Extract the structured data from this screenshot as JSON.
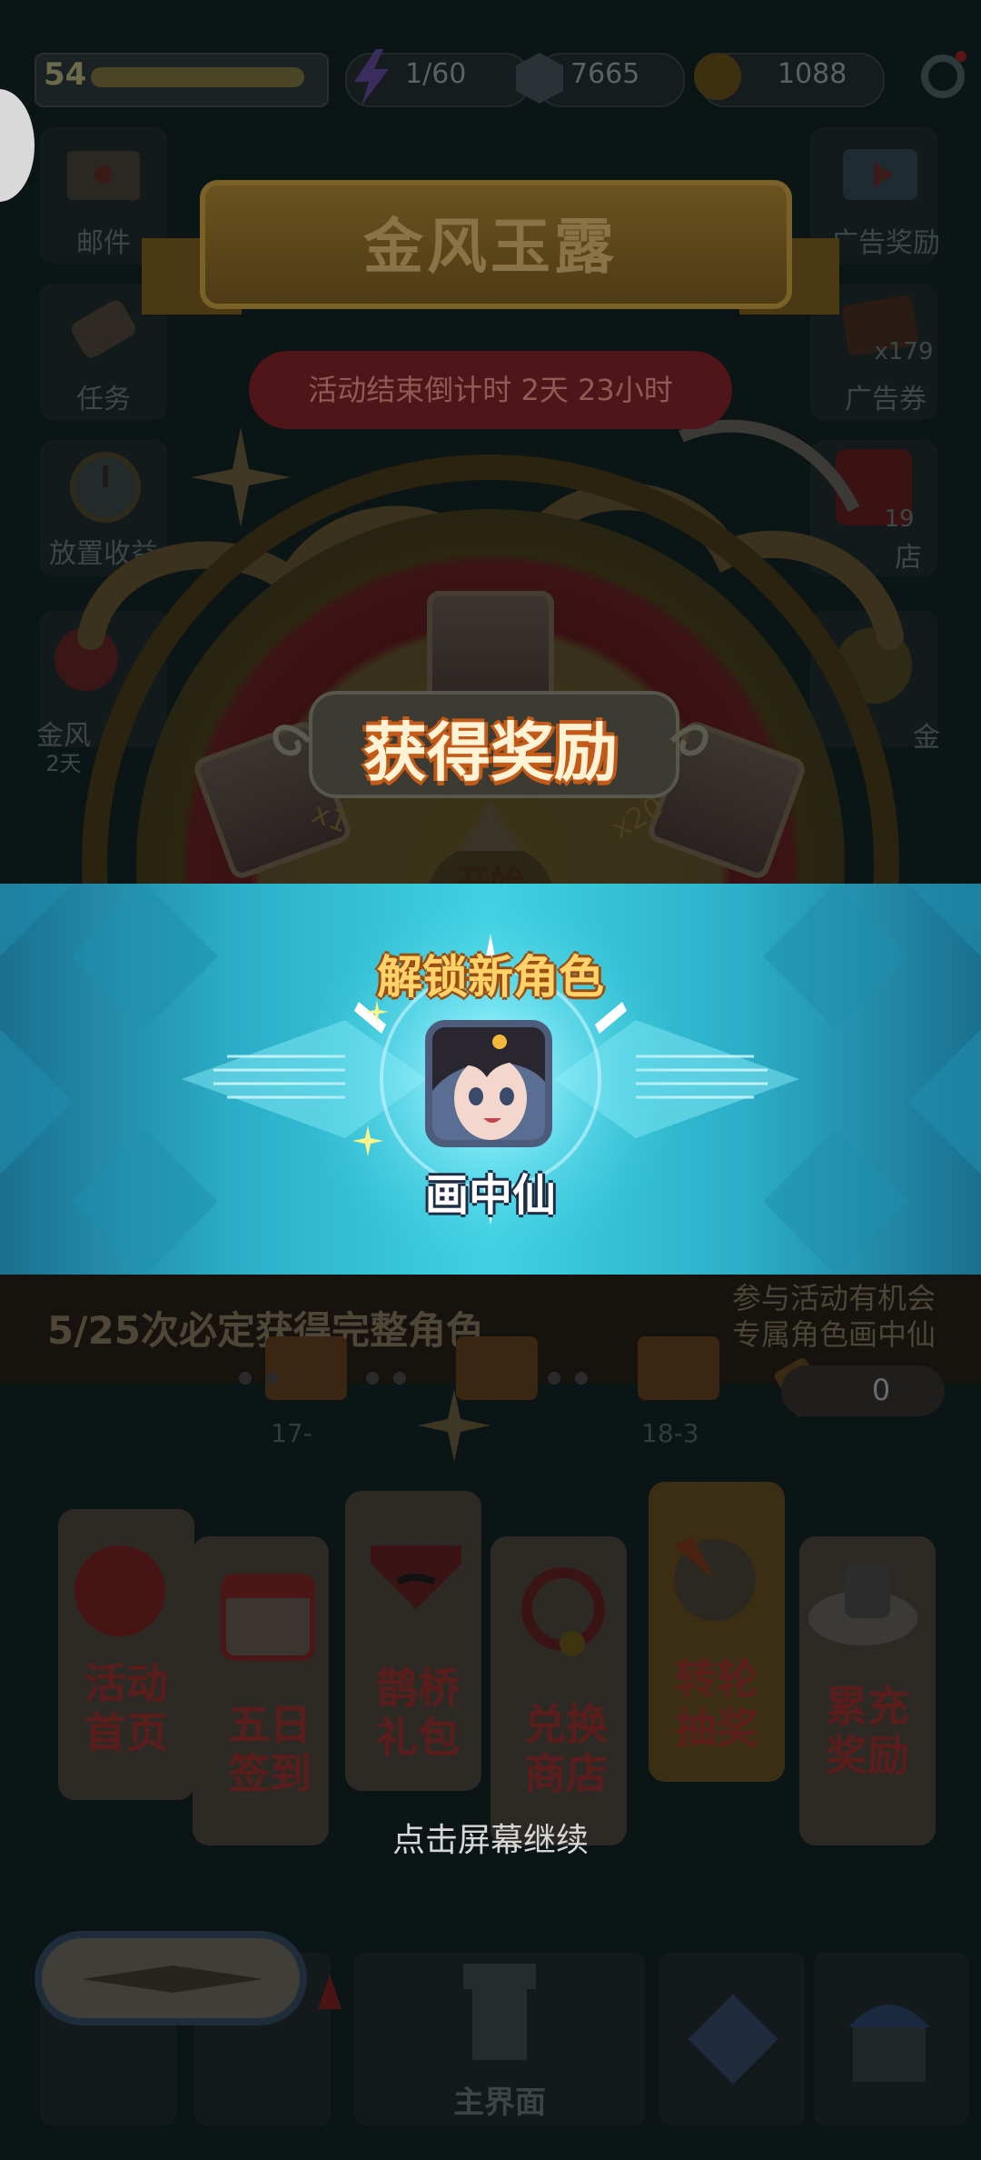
{
  "top_bar": {
    "level": "54",
    "energy": "1/60",
    "gems": "7665",
    "coins": "1088"
  },
  "side_menu": {
    "left": [
      {
        "label": "邮件",
        "icon": "mail-icon"
      },
      {
        "label": "任务",
        "icon": "scroll-icon"
      },
      {
        "label": "放置收益",
        "icon": "clock-icon"
      },
      {
        "label": "金风",
        "icon": "event-icon",
        "sub": "2天"
      }
    ],
    "right": [
      {
        "label": "广告奖励",
        "icon": "video-icon"
      },
      {
        "label": "广告券",
        "icon": "ticket-icon",
        "badge": "x179"
      },
      {
        "label": "店",
        "icon": "shop-icon",
        "badge": "19"
      },
      {
        "label": "金",
        "icon": "coin-icon"
      }
    ]
  },
  "event": {
    "title": "金风玉露",
    "countdown": "活动结束倒计时  2天 23小时",
    "wheel_labels": [
      "x1",
      "x20",
      "开始"
    ]
  },
  "reward_popup": {
    "title": "获得奖励",
    "subtitle": "解锁新角色",
    "character_name": "画中仙",
    "continue_hint": "点击屏幕继续"
  },
  "progress": {
    "guarantee_text": "5/25次必定获得完整角色",
    "promo_line1": "参与活动有机会",
    "promo_line2": "专属角色画中仙",
    "count": "0",
    "stages": [
      "17-",
      "18-3"
    ]
  },
  "nav_cards": [
    {
      "label1": "活动",
      "label2": "首页",
      "icon": "knot-icon"
    },
    {
      "label1": "五日",
      "label2": "签到",
      "icon": "calendar-icon"
    },
    {
      "label1": "鹊桥",
      "label2": "礼包",
      "icon": "gift-icon"
    },
    {
      "label1": "兑换",
      "label2": "商店",
      "icon": "bell-icon"
    },
    {
      "label1": "转轮",
      "label2": "抽奖",
      "icon": "wheel-icon"
    },
    {
      "label1": "累充",
      "label2": "奖励",
      "icon": "cloud-icon"
    }
  ],
  "bottom_nav": {
    "main_label": "主界面"
  },
  "colors": {
    "band_center": "#3fd1e2",
    "band_edge": "#1b6f8f",
    "title_orange": "#c45a17",
    "unlock_yellow": "#ffd36a"
  }
}
